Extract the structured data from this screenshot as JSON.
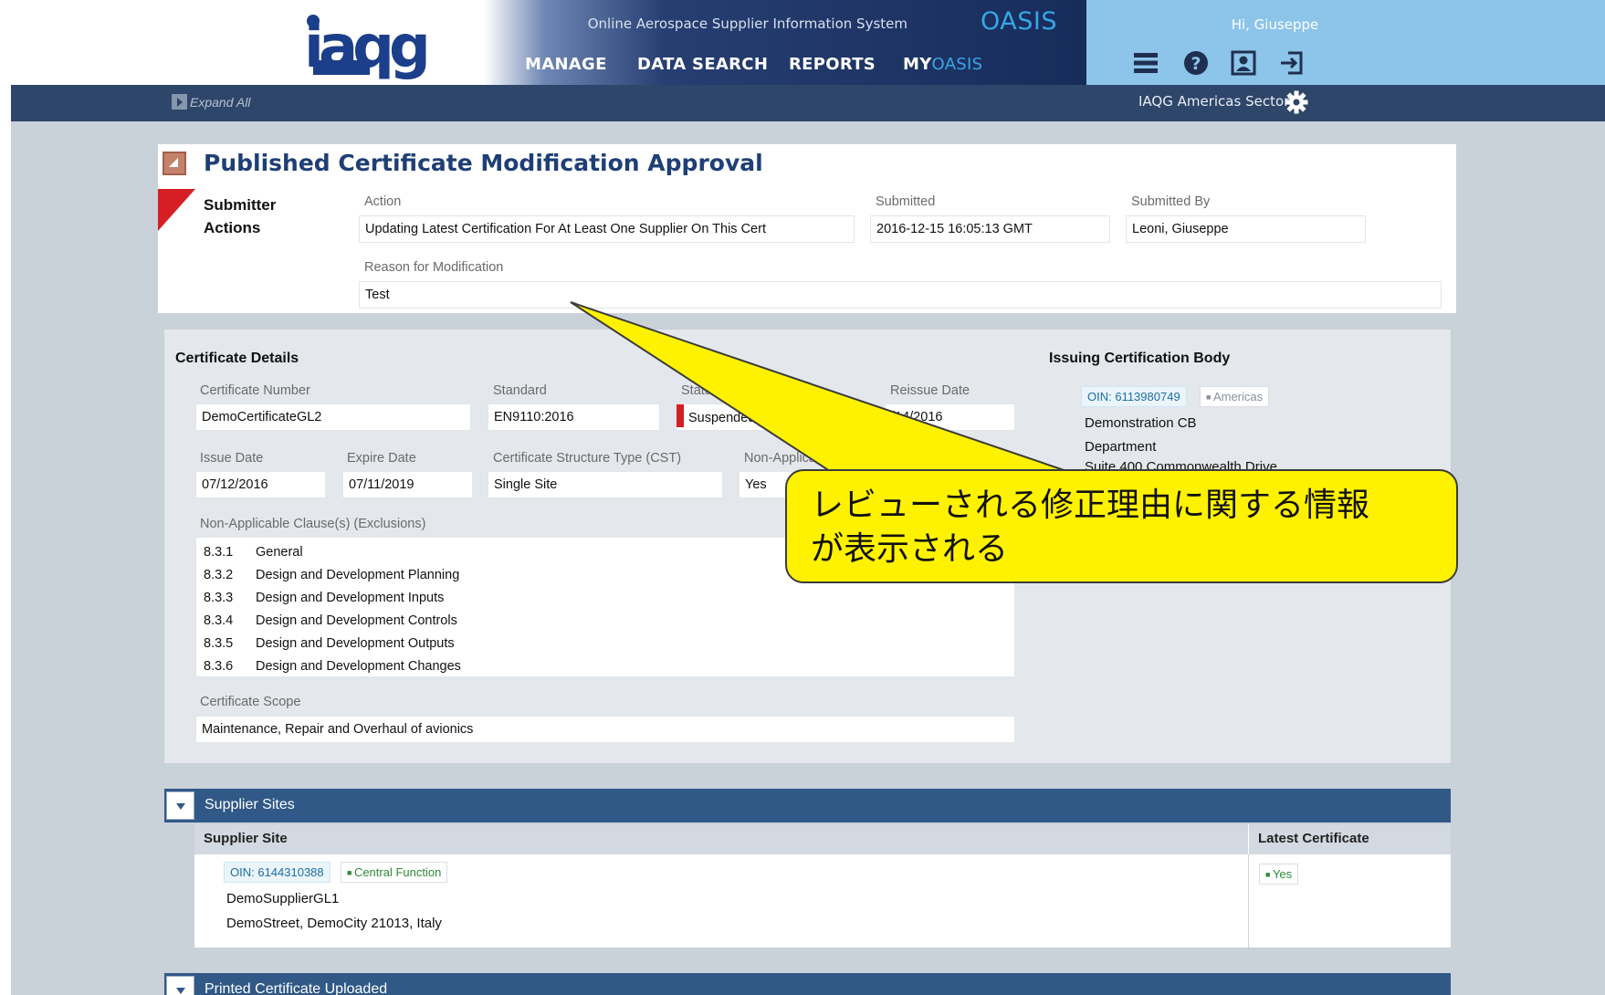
{
  "header": {
    "logo_text": "iaqg",
    "system_title": "Online Aerospace Supplier Information System",
    "system_name": "OASIS",
    "nav": {
      "manage": "MANAGE",
      "data_search": "DATA SEARCH",
      "reports": "REPORTS",
      "my_prefix": "MY",
      "my_suffix": "OASIS"
    },
    "greeting": "Hi, Giuseppe",
    "icons": [
      "menu-icon",
      "help-icon",
      "profile-icon",
      "logout-icon"
    ]
  },
  "subbar": {
    "expand_all": "Expand All",
    "sector": "IAQG Americas Sector"
  },
  "approval": {
    "title": "Published Certificate Modification Approval",
    "submitter_actions": "Submitter Actions",
    "action_label": "Action",
    "action_value": "Updating Latest Certification For At Least One Supplier On This Cert",
    "submitted_label": "Submitted",
    "submitted_value": "2016-12-15 16:05:13 GMT",
    "submitted_by_label": "Submitted By",
    "submitted_by_value": "Leoni, Giuseppe",
    "reason_label": "Reason for Modification",
    "reason_value": "Test"
  },
  "certificate": {
    "heading": "Certificate Details",
    "number_label": "Certificate Number",
    "number_value": "DemoCertificateGL2",
    "standard_label": "Standard",
    "standard_value": "EN9110:2016",
    "status_label": "Status",
    "status_value": "Suspended",
    "reissue_label": "Reissue Date",
    "reissue_value": "/14/2016",
    "issue_label": "Issue Date",
    "issue_value": "07/12/2016",
    "expire_label": "Expire Date",
    "expire_value": "07/11/2019",
    "cst_label": "Certificate Structure Type (CST)",
    "cst_value": "Single Site",
    "nac_label": "Non-Applicable Claus",
    "nac_value": "Yes",
    "exclusions_label": "Non-Applicable Clause(s) (Exclusions)",
    "exclusions": [
      {
        "num": "8.3.1",
        "text": "General"
      },
      {
        "num": "8.3.2",
        "text": "Design and Development Planning"
      },
      {
        "num": "8.3.3",
        "text": "Design and Development Inputs"
      },
      {
        "num": "8.3.4",
        "text": "Design and Development Controls"
      },
      {
        "num": "8.3.5",
        "text": "Design and Development Outputs"
      },
      {
        "num": "8.3.6",
        "text": "Design and Development Changes"
      }
    ],
    "scope_label": "Certificate Scope",
    "scope_value": "Maintenance, Repair and Overhaul of avionics"
  },
  "issuing_body": {
    "heading": "Issuing Certification Body",
    "oin": "OIN: 6113980749",
    "region": "Americas",
    "name": "Demonstration CB",
    "department": "Department",
    "address_partial": "Suite 400 Commonwealth Drive"
  },
  "supplier_sites": {
    "panel_title": "Supplier Sites",
    "col_site": "Supplier Site",
    "col_latest": "Latest Certificate",
    "row": {
      "oin": "OIN: 6144310388",
      "function": "Central Function",
      "name": "DemoSupplierGL1",
      "address": "DemoStreet, DemoCity 21013, Italy",
      "latest": "Yes"
    }
  },
  "printed_panel": {
    "title": "Printed Certificate Uploaded"
  },
  "callout": {
    "line1": "レビューされる修正理由に関する情報",
    "line2": "が表示される"
  },
  "colors": {
    "brand_navy": "#182c5a",
    "accent_blue": "#35a8e8",
    "user_bar": "#8cc4ea",
    "panel_blue": "#315987",
    "status_red": "#d61f24",
    "callout_yellow": "#fff200"
  }
}
